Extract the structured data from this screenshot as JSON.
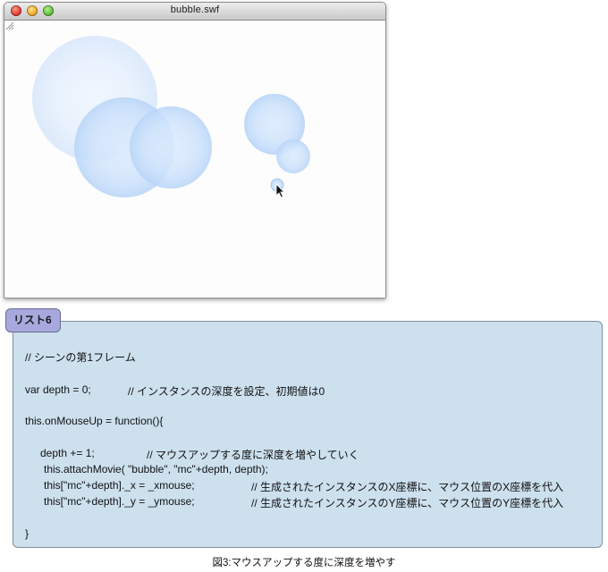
{
  "window": {
    "title": "bubble.swf",
    "controls": [
      "close-button",
      "minimize-button",
      "zoom-button"
    ]
  },
  "stage": {
    "bubble_color": "#cfe3fb",
    "bubble_edge": "#b4d2f5",
    "cursor": "arrow-cursor-icon"
  },
  "listing": {
    "tab_label": "リスト6",
    "lines": [
      "// シーンの第1フレーム",
      "var depth = 0;",
      "// インスタンスの深度を設定、初期値は0",
      "this.onMouseUp = function(){",
      "depth += 1;",
      "// マウスアップする度に深度を増やしていく",
      "this.attachMovie( \"bubble\", \"mc\"+depth, depth);",
      "this[\"mc\"+depth]._x = _xmouse;",
      "// 生成されたインスタンスのX座標に、マウス位置のX座標を代入",
      "this[\"mc\"+depth]._y = _ymouse;",
      "// 生成されたインスタンスのY座標に、マウス位置のY座標を代入",
      "}"
    ]
  },
  "caption": "図3:マウスアップする度に深度を増やす"
}
